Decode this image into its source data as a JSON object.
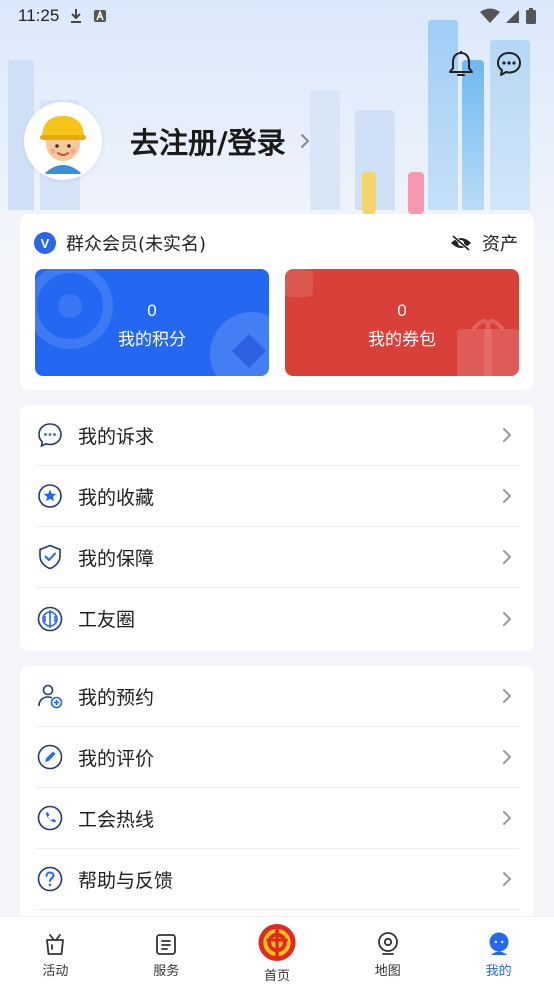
{
  "status_bar": {
    "time": "11:25"
  },
  "profile": {
    "login_label": "去注册/登录"
  },
  "member": {
    "badge": "V",
    "label": "群众会员(未实名)",
    "assets_label": "资产",
    "tiles": [
      {
        "value": "0",
        "label": "我的积分",
        "color": "#2468f2"
      },
      {
        "value": "0",
        "label": "我的券包",
        "color": "#d9403a"
      }
    ]
  },
  "menu_group_1": [
    {
      "label": "我的诉求",
      "icon": "chat-bubble-icon"
    },
    {
      "label": "我的收藏",
      "icon": "star-badge-icon"
    },
    {
      "label": "我的保障",
      "icon": "shield-check-icon"
    },
    {
      "label": "工友圈",
      "icon": "union-circle-icon"
    }
  ],
  "menu_group_2": [
    {
      "label": "我的预约",
      "icon": "user-add-icon"
    },
    {
      "label": "我的评价",
      "icon": "pencil-icon"
    },
    {
      "label": "工会热线",
      "icon": "phone-icon"
    },
    {
      "label": "帮助与反馈",
      "icon": "question-icon"
    }
  ],
  "tabs": [
    {
      "label": "活动",
      "icon": "gift-box-icon"
    },
    {
      "label": "服务",
      "icon": "list-icon"
    },
    {
      "label": "首页",
      "icon": "union-logo-icon"
    },
    {
      "label": "地图",
      "icon": "location-pin-icon"
    },
    {
      "label": "我的",
      "icon": "person-icon",
      "active": true
    }
  ],
  "colors": {
    "accent": "#2468f2",
    "red": "#d9403a",
    "background": "#f3f5f9"
  }
}
